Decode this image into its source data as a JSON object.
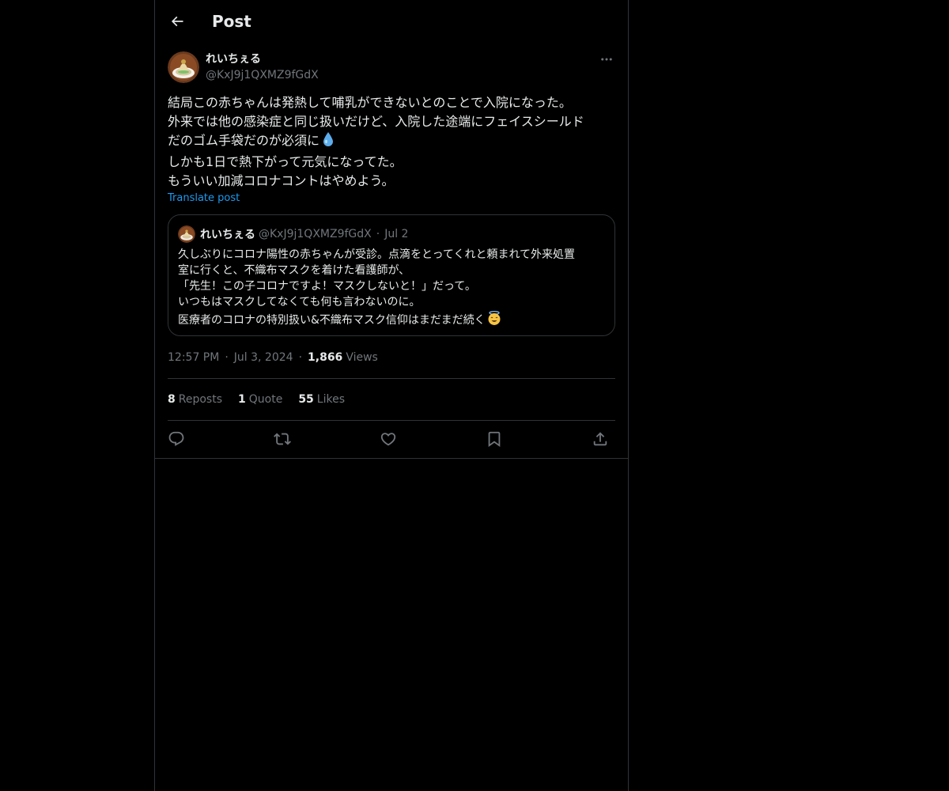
{
  "header": {
    "title": "Post"
  },
  "post": {
    "author_name": "れいちぇる",
    "author_handle": "@KxJ9j1QXMZ9fGdX",
    "text_lines": [
      "結局この赤ちゃんは発熱して哺乳ができないとのことで入院になった。",
      "外来では他の感染症と同じ扱いだけど、入院した途端にフェイスシールド",
      "だのゴム手袋だのが必須に",
      "しかも1日で熱下がって元気になってた。",
      "もういい加減コロナコントはやめよう。"
    ],
    "translate_label": "Translate post",
    "time": "12:57 PM",
    "date": "Jul 3, 2024",
    "views_count": "1,866",
    "views_label": "Views",
    "separator": "·"
  },
  "quote": {
    "author_name": "れいちぇる",
    "author_handle": "@KxJ9j1QXMZ9fGdX",
    "date": "Jul 2",
    "text_lines": [
      "久しぶりにコロナ陽性の赤ちゃんが受診。点滴をとってくれと頼まれて外来処置",
      "室に行くと、不織布マスクを着けた看護師が、",
      "「先生！この子コロナですよ！マスクしないと！」だって。",
      "いつもはマスクしてなくても何も言わないのに。",
      "医療者のコロナの特別扱い&不織布マスク信仰はまだまだ続く"
    ]
  },
  "stats": {
    "reposts_count": "8",
    "reposts_label": "Reposts",
    "quotes_count": "1",
    "quotes_label": "Quote",
    "likes_count": "55",
    "likes_label": "Likes"
  },
  "actions": [
    "reply-icon",
    "repost-icon",
    "like-icon",
    "bookmark-icon",
    "share-icon"
  ],
  "colors": {
    "background": "#000000",
    "text": "#e7e9ea",
    "muted": "#71767b",
    "link": "#1d9bf0",
    "border": "#2f3336"
  }
}
